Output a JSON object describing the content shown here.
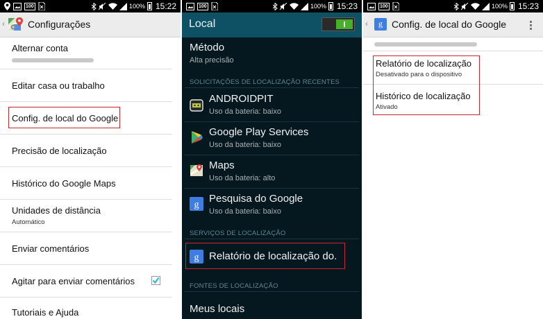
{
  "screens": [
    {
      "status": {
        "indicator_100": "100",
        "battery_pct": "100%",
        "time": "15:22"
      },
      "header": {
        "title": "Configurações",
        "app_icon": "maps-settings-icon"
      },
      "rows": [
        {
          "label": "Alternar conta",
          "sub": ""
        },
        {
          "label": "Editar casa ou trabalho",
          "sub": ""
        },
        {
          "label": "Config. de local do Google",
          "sub": ""
        },
        {
          "label": "Precisão de localização",
          "sub": ""
        },
        {
          "label": "Histórico do Google Maps",
          "sub": ""
        },
        {
          "label": "Unidades de distância",
          "sub": "Automático"
        },
        {
          "label": "Enviar comentários",
          "sub": ""
        },
        {
          "label": "Agitar para enviar comentários",
          "sub": "",
          "checked": true
        },
        {
          "label": "Tutoriais e Ajuda",
          "sub": ""
        }
      ]
    },
    {
      "status": {
        "indicator_100": "100",
        "battery_pct": "100%",
        "time": "15:23"
      },
      "header": {
        "title": "Local",
        "toggle_on": true
      },
      "mode": {
        "title": "Método",
        "value": "Alta precisão"
      },
      "section_recent": "SOLICITAÇÕES DE LOCALIZAÇÃO RECENTES",
      "apps": [
        {
          "name": "ANDROIDPIT",
          "usage": "Uso da bateria: baixo",
          "icon": "androidpit-icon"
        },
        {
          "name": "Google Play Services",
          "usage": "Uso da bateria: baixo",
          "icon": "play-services-icon"
        },
        {
          "name": "Maps",
          "usage": "Uso da bateria: alto",
          "icon": "maps-icon"
        },
        {
          "name": "Pesquisa do Google",
          "usage": "Uso da bateria: baixo",
          "icon": "google-search-icon"
        }
      ],
      "section_services": "SERVIÇOS DE LOCALIZAÇÃO",
      "service": {
        "name": "Relatório de localização do.",
        "icon": "google-g-icon"
      },
      "section_sources": "FONTES DE LOCALIZAÇÃO",
      "source": {
        "name": "Meus locais"
      }
    },
    {
      "status": {
        "indicator_100": "100",
        "battery_pct": "100%",
        "time": "15:23"
      },
      "header": {
        "title": "Config. de local do Google",
        "icon": "google-g-icon"
      },
      "items": [
        {
          "title": "Relatório de localização",
          "sub": "Desativado para o dispositivo"
        },
        {
          "title": "Histórico de localização",
          "sub": "Ativado"
        }
      ]
    }
  ],
  "colors": {
    "accent_dark_header": "#0e5164",
    "dark_background": "#05181f",
    "highlight_border": "#c6262e",
    "checkbox_blue": "#33b5e5",
    "toggle_green": "#47b02a"
  }
}
